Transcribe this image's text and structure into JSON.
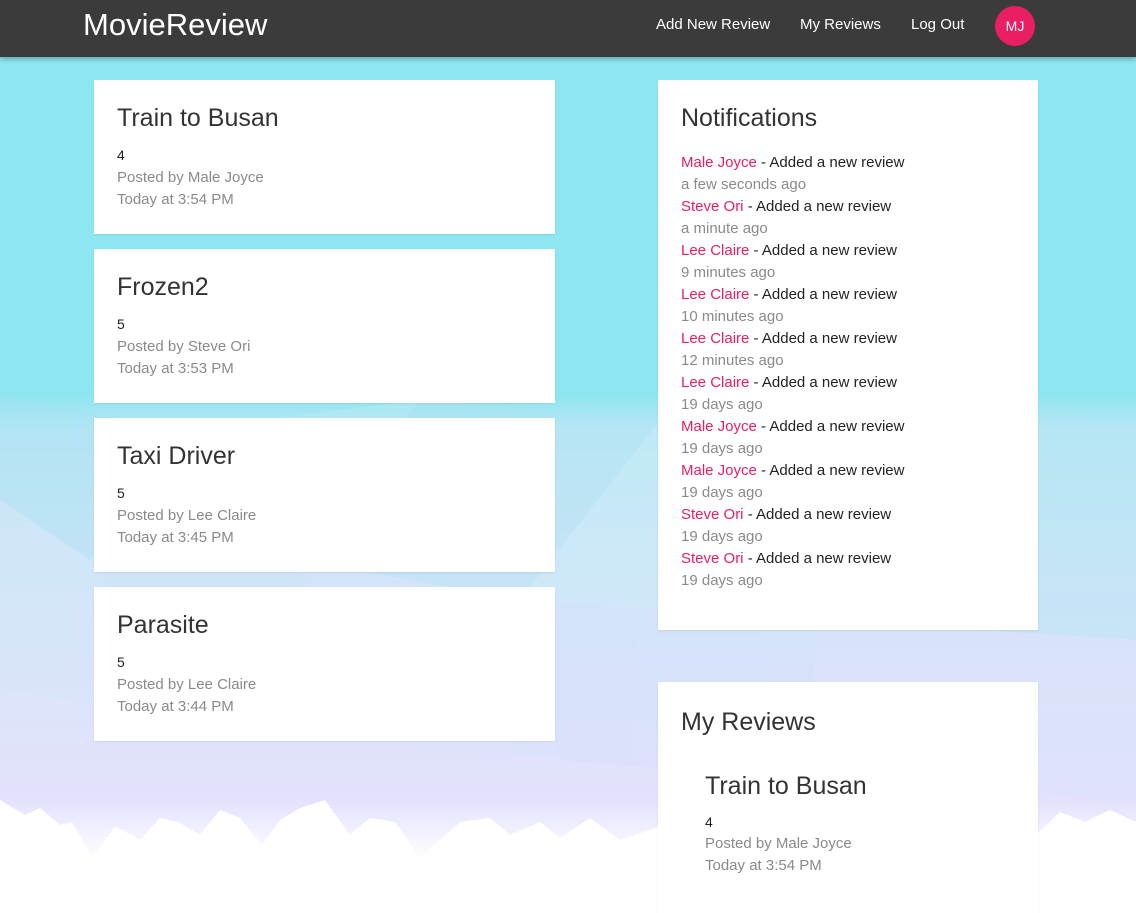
{
  "brand": "MovieReview",
  "nav": {
    "add_review": "Add New Review",
    "my_reviews": "My Reviews",
    "log_out": "Log Out",
    "avatar_initials": "MJ"
  },
  "reviews": [
    {
      "title": "Train to Busan",
      "rating": "4",
      "posted_by": "Posted by Male Joyce",
      "time": "Today at 3:54 PM"
    },
    {
      "title": "Frozen2",
      "rating": "5",
      "posted_by": "Posted by Steve Ori",
      "time": "Today at 3:53 PM"
    },
    {
      "title": "Taxi Driver",
      "rating": "5",
      "posted_by": "Posted by Lee Claire",
      "time": "Today at 3:45 PM"
    },
    {
      "title": "Parasite",
      "rating": "5",
      "posted_by": "Posted by Lee Claire",
      "time": "Today at 3:44 PM"
    }
  ],
  "notifications": {
    "title": "Notifications",
    "items": [
      {
        "user": "Male Joyce",
        "action": " - Added a new review",
        "time": "a few seconds ago"
      },
      {
        "user": "Steve Ori",
        "action": " - Added a new review",
        "time": "a minute ago"
      },
      {
        "user": "Lee Claire",
        "action": " - Added a new review",
        "time": "9 minutes ago"
      },
      {
        "user": "Lee Claire",
        "action": " - Added a new review",
        "time": "10 minutes ago"
      },
      {
        "user": "Lee Claire",
        "action": " - Added a new review",
        "time": "12 minutes ago"
      },
      {
        "user": "Lee Claire",
        "action": " - Added a new review",
        "time": "19 days ago"
      },
      {
        "user": "Male Joyce",
        "action": " - Added a new review",
        "time": "19 days ago"
      },
      {
        "user": "Male Joyce",
        "action": " - Added a new review",
        "time": "19 days ago"
      },
      {
        "user": "Steve Ori",
        "action": " - Added a new review",
        "time": "19 days ago"
      },
      {
        "user": "Steve Ori",
        "action": " - Added a new review",
        "time": "19 days ago"
      }
    ]
  },
  "my_reviews": {
    "title": "My Reviews",
    "items": [
      {
        "title": "Train to Busan",
        "rating": "4",
        "posted_by": "Posted by Male Joyce",
        "time": "Today at 3:54 PM"
      }
    ]
  },
  "colors": {
    "navbar": "#3b3b3b",
    "accent": "#e91e63",
    "background_top": "#8ee6f0"
  }
}
